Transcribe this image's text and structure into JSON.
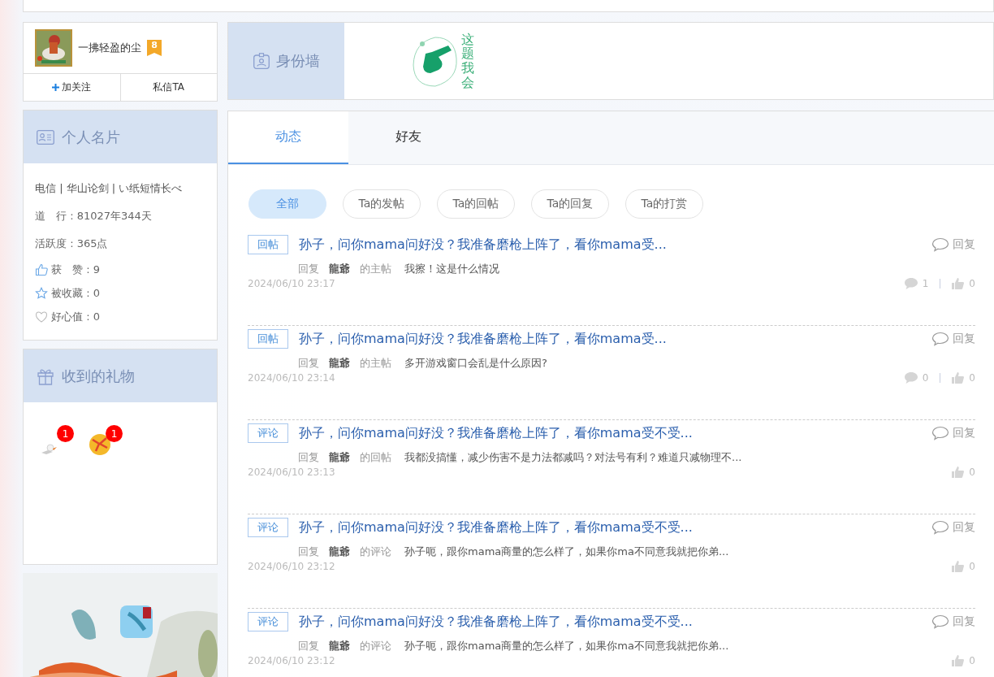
{
  "profile": {
    "name": "一拂轻盈的尘",
    "level": "8",
    "follow_button": "加关注",
    "message_button": "私信TA"
  },
  "info_card": {
    "title": "个人名片",
    "rows": [
      {
        "kind": "plain",
        "text": "电信 | 华山论剑 | い纸短情长べ"
      },
      {
        "kind": "plain",
        "text": "道　行 : 81027年344天"
      },
      {
        "kind": "plain",
        "text": "活跃度 : 365点"
      },
      {
        "kind": "like",
        "text": "获　赞 : 9"
      },
      {
        "kind": "star",
        "text": "被收藏 : 0"
      },
      {
        "kind": "heart",
        "text": "好心值 : 0"
      }
    ]
  },
  "gift_card": {
    "title": "收到的礼物",
    "gifts": [
      {
        "kind": "figure",
        "count": "1"
      },
      {
        "kind": "ball",
        "count": "1"
      }
    ]
  },
  "id_wall": {
    "title": "身份墙",
    "badge_text": "这题我会"
  },
  "tabs": [
    {
      "label": "动态",
      "selected": true
    },
    {
      "label": "好友",
      "selected": false
    }
  ],
  "filters": [
    {
      "label": "全部",
      "selected": true
    },
    {
      "label": "Ta的发帖",
      "selected": false
    },
    {
      "label": "Ta的回帖",
      "selected": false
    },
    {
      "label": "Ta的回复",
      "selected": false
    },
    {
      "label": "Ta的打赏",
      "selected": false
    }
  ],
  "posts": [
    {
      "tag": "回帖",
      "title": "孙子，问你mama问好没？我准备磨枪上阵了，看你mama受...",
      "reply": "回复",
      "meta_action": "回复",
      "user": "龍爺",
      "target": "的主帖",
      "content": "我擦！这是什么情况",
      "date": "2024/06/10 23:17",
      "comments": "1",
      "likes": "0"
    },
    {
      "tag": "回帖",
      "title": "孙子，问你mama问好没？我准备磨枪上阵了，看你mama受...",
      "reply": "回复",
      "meta_action": "回复",
      "user": "龍爺",
      "target": "的主帖",
      "content": "多开游戏窗口会乱是什么原因?",
      "date": "2024/06/10 23:14",
      "comments": "0",
      "likes": "0"
    },
    {
      "tag": "评论",
      "title": "孙子，问你mama问好没？我准备磨枪上阵了，看你mama受不受...",
      "reply": "回复",
      "meta_action": "回复",
      "user": "龍爺",
      "target": "的回帖",
      "content": "我都没搞懂，减少伤害不是力法都减吗？对法号有利？难道只减物理不...",
      "date": "2024/06/10 23:13",
      "likes": "0"
    },
    {
      "tag": "评论",
      "title": "孙子，问你mama问好没？我准备磨枪上阵了，看你mama受不受...",
      "reply": "回复",
      "meta_action": "回复",
      "user": "龍爺",
      "target": "的评论",
      "content": "孙子呃，跟你mama商量的怎么样了，如果你ma不同意我就把你弟...",
      "date": "2024/06/10 23:12",
      "likes": "0"
    },
    {
      "tag": "评论",
      "title": "孙子，问你mama问好没？我准备磨枪上阵了，看你mama受不受...",
      "reply": "回复",
      "meta_action": "回复",
      "user": "龍爺",
      "target": "的评论",
      "content": "孙子呃，跟你mama商量的怎么样了，如果你ma不同意我就把你弟...",
      "date": "2024/06/10 23:12",
      "likes": "0"
    }
  ]
}
